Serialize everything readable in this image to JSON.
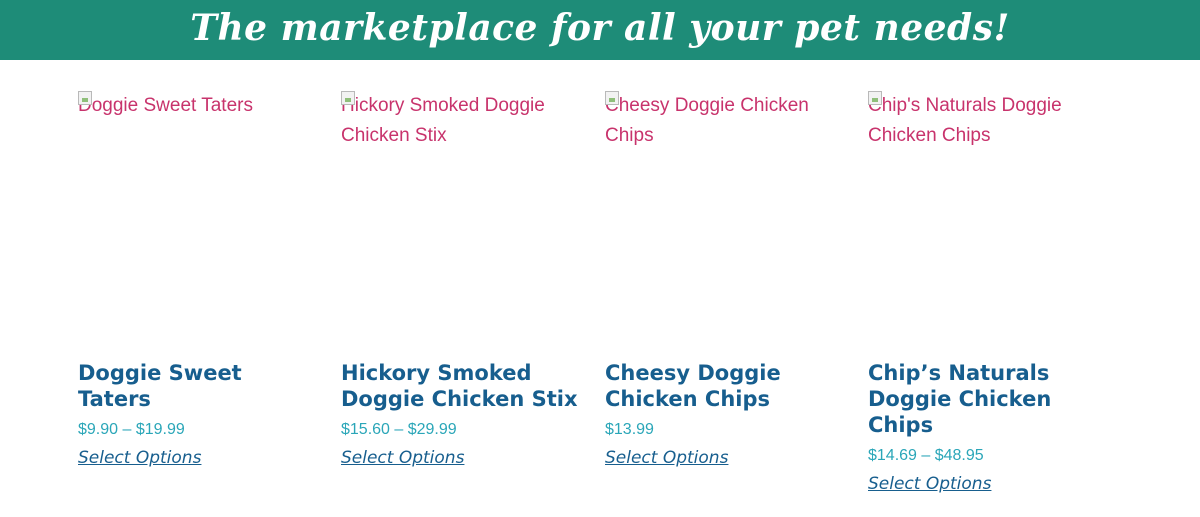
{
  "banner": {
    "title": "The marketplace for all your pet needs!"
  },
  "products": [
    {
      "image_alt": "Doggie Sweet Taters",
      "name": "Doggie Sweet Taters",
      "price": "$9.90 – $19.99",
      "action_label": "Select Options"
    },
    {
      "image_alt": "Hickory Smoked Doggie Chicken Stix",
      "name": "Hickory Smoked Doggie Chicken Stix",
      "price": "$15.60 – $29.99",
      "action_label": "Select Options"
    },
    {
      "image_alt": "Cheesy Doggie Chicken Chips",
      "name": "Cheesy Doggie Chicken Chips",
      "price": "$13.99",
      "action_label": "Select Options"
    },
    {
      "image_alt": "Chip's Naturals Doggie Chicken Chips",
      "name": "Chip’s Naturals Doggie Chicken Chips",
      "price": "$14.69 – $48.95",
      "action_label": "Select Options"
    }
  ],
  "colors": {
    "banner_bg": "#1e8c78",
    "product_title": "#175e8e",
    "price": "#2aa6b8",
    "image_alt_text": "#c8336c"
  },
  "icons": {
    "broken_image": "broken-image-icon"
  }
}
